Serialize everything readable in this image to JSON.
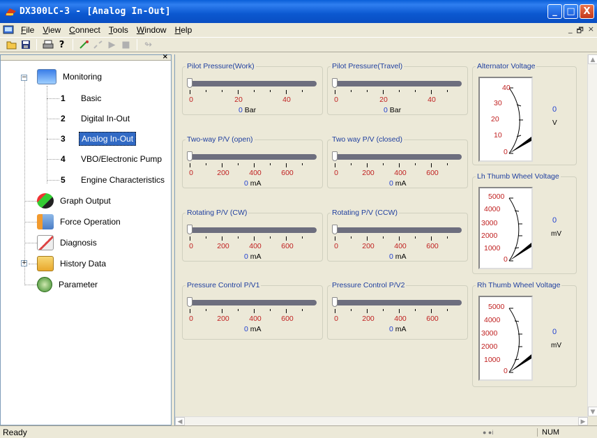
{
  "window": {
    "title": "DX300LC-3 - [Analog In-Out]",
    "controls": [
      "_",
      "□",
      "X"
    ]
  },
  "menu": [
    "File",
    "View",
    "Connect",
    "Tools",
    "Window",
    "Help"
  ],
  "mdi_controls": [
    "_",
    "🗗",
    "×"
  ],
  "toolbar": {
    "icons": [
      "open-icon",
      "save-icon",
      "print-icon",
      "help-icon",
      "connect-icon",
      "disconnect-icon",
      "play-icon",
      "stop-icon",
      "arrow-icon"
    ]
  },
  "tree": {
    "root": "Monitoring",
    "children": [
      {
        "num": "1",
        "label": "Basic"
      },
      {
        "num": "2",
        "label": "Digital In-Out"
      },
      {
        "num": "3",
        "label": "Analog In-Out"
      },
      {
        "num": "4",
        "label": "VBO/Electronic Pump"
      },
      {
        "num": "5",
        "label": "Engine Characteristics"
      }
    ],
    "items": [
      "Graph Output",
      "Force Operation",
      "Diagnosis",
      "History Data",
      "Parameter"
    ],
    "selected": "Analog In-Out"
  },
  "sliders": [
    {
      "title": "Pilot Pressure(Work)",
      "ticks": [
        "0",
        "20",
        "40"
      ],
      "value": "0",
      "unit": "Bar"
    },
    {
      "title": "Pilot Pressure(Travel)",
      "ticks": [
        "0",
        "20",
        "40"
      ],
      "value": "0",
      "unit": "Bar"
    },
    {
      "title": "Two-way P/V (open)",
      "ticks": [
        "0",
        "200",
        "400",
        "600"
      ],
      "value": "0",
      "unit": "mA"
    },
    {
      "title": "Two way P/V (closed)",
      "ticks": [
        "0",
        "200",
        "400",
        "600"
      ],
      "value": "0",
      "unit": "mA"
    },
    {
      "title": "Rotating P/V (CW)",
      "ticks": [
        "0",
        "200",
        "400",
        "600"
      ],
      "value": "0",
      "unit": "mA"
    },
    {
      "title": "Rotating P/V (CCW)",
      "ticks": [
        "0",
        "200",
        "400",
        "600"
      ],
      "value": "0",
      "unit": "mA"
    },
    {
      "title": "Pressure Control P/V1",
      "ticks": [
        "0",
        "200",
        "400",
        "600"
      ],
      "value": "0",
      "unit": "mA"
    },
    {
      "title": "Pressure Control P/V2",
      "ticks": [
        "0",
        "200",
        "400",
        "600"
      ],
      "value": "0",
      "unit": "mA"
    }
  ],
  "gauges": [
    {
      "title": "Alternator Voltage",
      "labels": [
        "40",
        "30",
        "20",
        "10",
        "0"
      ],
      "value": "0",
      "unit": "V"
    },
    {
      "title": "Lh Thumb Wheel Voltage",
      "labels": [
        "5000",
        "4000",
        "3000",
        "2000",
        "1000",
        "0"
      ],
      "value": "0",
      "unit": "mV"
    },
    {
      "title": "Rh Thumb Wheel Voltage",
      "labels": [
        "5000",
        "4000",
        "3000",
        "2000",
        "1000",
        "0"
      ],
      "value": "0",
      "unit": "mV"
    }
  ],
  "status": {
    "text": "Ready",
    "indicator": "NUM"
  }
}
